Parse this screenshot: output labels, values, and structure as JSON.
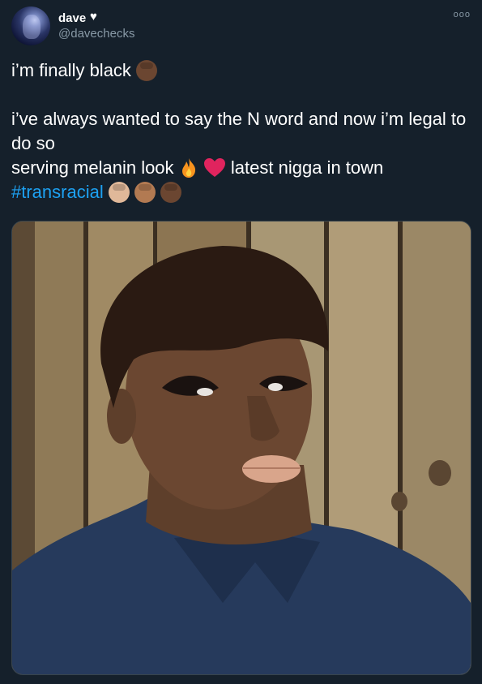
{
  "author": {
    "display_name": "dave",
    "handle": "@davechecks",
    "name_icon": "white-heart-icon"
  },
  "more_label": "ooo",
  "tweet": {
    "line1": "i’m finally black",
    "line2": "i’ve always wanted to say the N word and now i’m legal to do so",
    "line3a": "serving melanin look",
    "line3b": "latest nigga in town",
    "hashtag": "#transracial"
  },
  "media": {
    "type": "photo",
    "icon": "portrait-photo"
  },
  "colors": {
    "background": "#15202b",
    "text": "#ffffff",
    "secondary_text": "#8899a6",
    "link": "#1da1f2"
  }
}
